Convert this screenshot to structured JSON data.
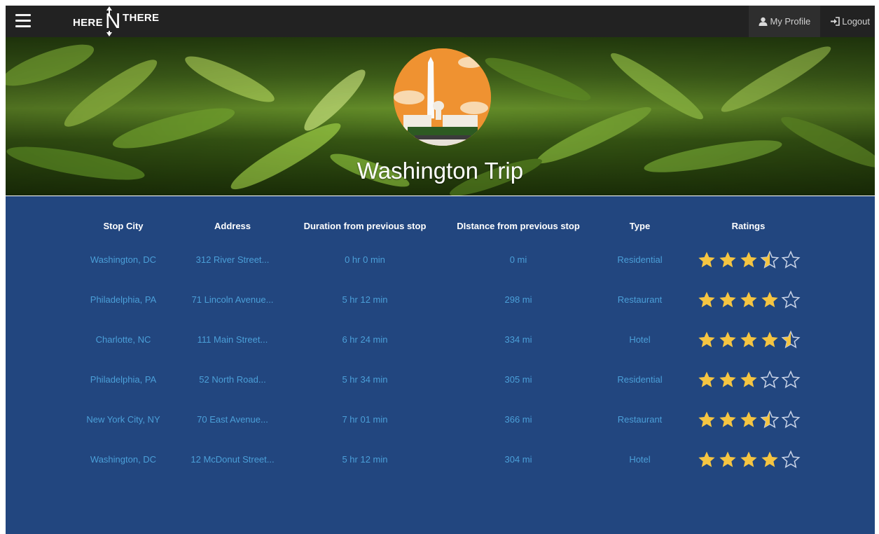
{
  "navbar": {
    "brand_left": "HERE",
    "brand_mid": "N",
    "brand_right": "THERE",
    "my_profile": "My Profile",
    "logout": "Logout",
    "icons": {
      "menu": "hamburger-icon",
      "profile": "user-icon",
      "logout": "logout-icon"
    }
  },
  "hero": {
    "title": "Washington Trip"
  },
  "table": {
    "headers": [
      "Stop City",
      "Address",
      "Duration from previous stop",
      "DIstance from previous stop",
      "Type",
      "Ratings"
    ],
    "rows": [
      {
        "city": "Washington, DC",
        "address": "312 River Street...",
        "duration": "0 hr 0 min",
        "distance": "0 mi",
        "type": "Residential",
        "rating": 3.5
      },
      {
        "city": "Philadelphia, PA",
        "address": "71 Lincoln Avenue...",
        "duration": "5 hr 12 min",
        "distance": "298 mi",
        "type": "Restaurant",
        "rating": 4
      },
      {
        "city": "Charlotte, NC",
        "address": "111 Main Street...",
        "duration": "6 hr 24 min",
        "distance": "334 mi",
        "type": "Hotel",
        "rating": 4.5
      },
      {
        "city": "Philadelphia, PA",
        "address": "52 North Road...",
        "duration": "5 hr 34 min",
        "distance": "305 mi",
        "type": "Residential",
        "rating": 3
      },
      {
        "city": "New York City, NY",
        "address": "70 East Avenue...",
        "duration": "7 hr 01 min",
        "distance": "366 mi",
        "type": "Restaurant",
        "rating": 3.5
      },
      {
        "city": "Washington, DC",
        "address": "12 McDonut Street...",
        "duration": "5 hr 12 min",
        "distance": "304 mi",
        "type": "Hotel",
        "rating": 4
      }
    ]
  },
  "colors": {
    "navbar_bg": "#222222",
    "main_bg": "#22467f",
    "cell_text": "#4b9fd8",
    "star_fill": "#f5c542",
    "hero_accent": "#ef9231"
  }
}
